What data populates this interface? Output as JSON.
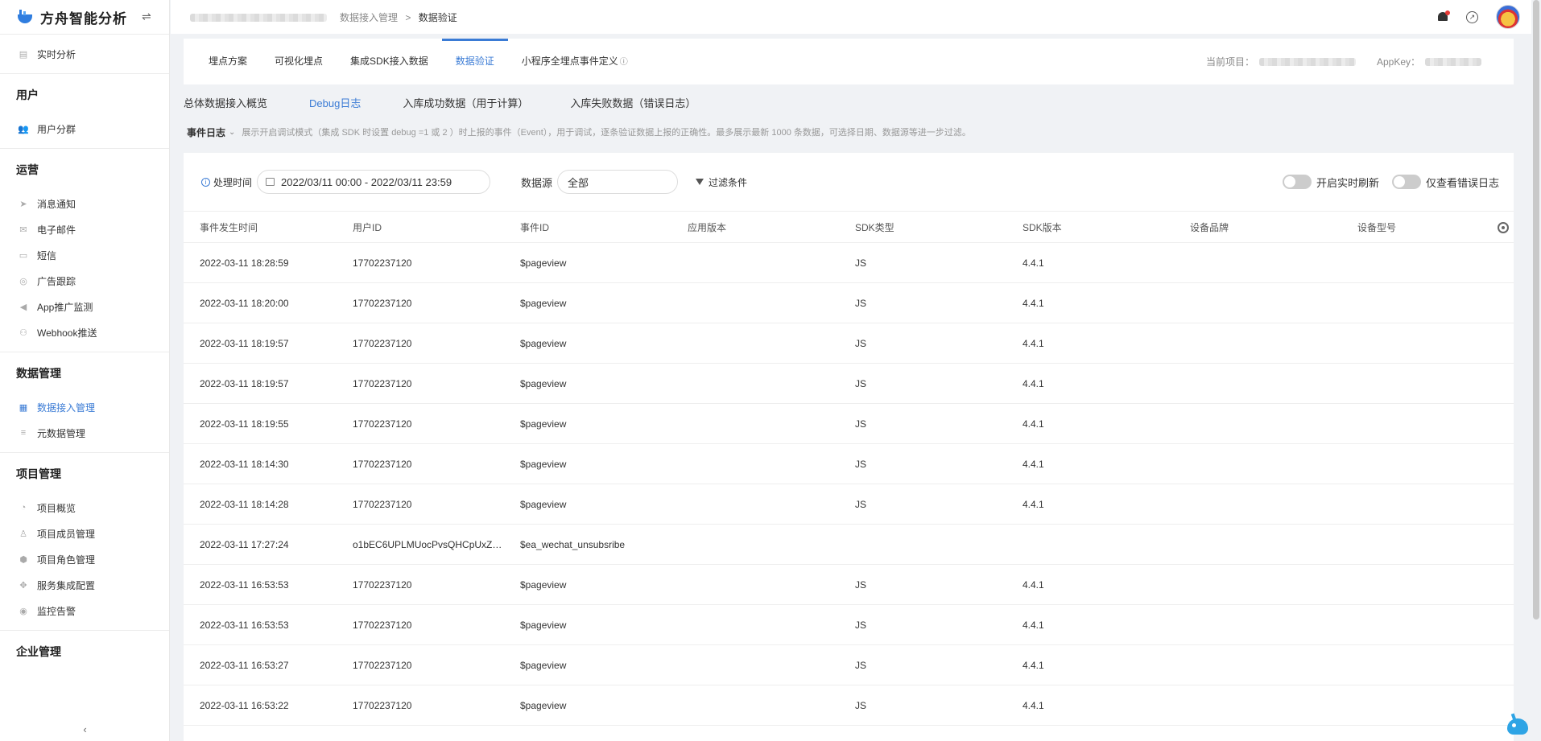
{
  "app": {
    "name": "方舟智能分析",
    "collapse_icon": "swap-icon"
  },
  "sidebar": {
    "items_top": [
      {
        "label": "实时分析",
        "icon": "realtime-icon"
      }
    ],
    "sections": [
      {
        "title": "用户",
        "items": [
          {
            "label": "用户分群",
            "icon": "users-icon"
          }
        ]
      },
      {
        "title": "运营",
        "items": [
          {
            "label": "消息通知",
            "icon": "send-icon"
          },
          {
            "label": "电子邮件",
            "icon": "mail-icon"
          },
          {
            "label": "短信",
            "icon": "chat-icon"
          },
          {
            "label": "广告跟踪",
            "icon": "target-icon"
          },
          {
            "label": "App推广监测",
            "icon": "megaphone-icon"
          },
          {
            "label": "Webhook推送",
            "icon": "robot-icon"
          }
        ]
      },
      {
        "title": "数据管理",
        "items": [
          {
            "label": "数据接入管理",
            "icon": "database-icon",
            "active": true
          },
          {
            "label": "元数据管理",
            "icon": "list-icon"
          }
        ]
      },
      {
        "title": "项目管理",
        "items": [
          {
            "label": "项目概览",
            "icon": "overview-icon"
          },
          {
            "label": "项目成员管理",
            "icon": "member-icon"
          },
          {
            "label": "项目角色管理",
            "icon": "role-icon"
          },
          {
            "label": "服务集成配置",
            "icon": "puzzle-icon"
          },
          {
            "label": "监控告警",
            "icon": "alarm-icon"
          }
        ]
      },
      {
        "title": "企业管理",
        "items": []
      }
    ],
    "collapse_label": "‹"
  },
  "topbar": {
    "breadcrumb": [
      "数据接入管理",
      "数据验证"
    ],
    "breadcrumb_sep": ">"
  },
  "tabs": [
    {
      "label": "埋点方案"
    },
    {
      "label": "可视化埋点"
    },
    {
      "label": "集成SDK接入数据"
    },
    {
      "label": "数据验证",
      "active": true
    },
    {
      "label": "小程序全埋点事件定义",
      "info": "ⓘ"
    }
  ],
  "project": {
    "current_label": "当前项目：",
    "appkey_label": "AppKey："
  },
  "subtabs": [
    {
      "label": "总体数据接入概览"
    },
    {
      "label": "Debug日志",
      "active": true
    },
    {
      "label": "入库成功数据（用于计算）"
    },
    {
      "label": "入库失败数据（错误日志）"
    }
  ],
  "event_log": {
    "title": "事件日志",
    "description": "展示开启调试模式（集成 SDK 时设置 debug =1 或 2 ）时上报的事件（Event），用于调试，逐条验证数据上报的正确性。最多展示最新 1000 条数据，可选择日期、数据源等进一步过滤。"
  },
  "filters": {
    "time_label": "处理时间",
    "date_range": "2022/03/11 00:00 - 2022/03/11 23:59",
    "source_label": "数据源",
    "source_value": "全部",
    "filter_label": "过滤条件",
    "toggle_realtime": "开启实时刷新",
    "toggle_errors": "仅查看错误日志"
  },
  "table": {
    "columns": [
      "事件发生时间",
      "用户ID",
      "事件ID",
      "应用版本",
      "SDK类型",
      "SDK版本",
      "设备品牌",
      "设备型号"
    ],
    "rows": [
      [
        "2022-03-11 18:28:59",
        "17702237120",
        "$pageview",
        "",
        "JS",
        "4.4.1",
        "",
        ""
      ],
      [
        "2022-03-11 18:20:00",
        "17702237120",
        "$pageview",
        "",
        "JS",
        "4.4.1",
        "",
        ""
      ],
      [
        "2022-03-11 18:19:57",
        "17702237120",
        "$pageview",
        "",
        "JS",
        "4.4.1",
        "",
        ""
      ],
      [
        "2022-03-11 18:19:57",
        "17702237120",
        "$pageview",
        "",
        "JS",
        "4.4.1",
        "",
        ""
      ],
      [
        "2022-03-11 18:19:55",
        "17702237120",
        "$pageview",
        "",
        "JS",
        "4.4.1",
        "",
        ""
      ],
      [
        "2022-03-11 18:14:30",
        "17702237120",
        "$pageview",
        "",
        "JS",
        "4.4.1",
        "",
        ""
      ],
      [
        "2022-03-11 18:14:28",
        "17702237120",
        "$pageview",
        "",
        "JS",
        "4.4.1",
        "",
        ""
      ],
      [
        "2022-03-11 17:27:24",
        "o1bEC6UPLMUocPvsQHCpUxZky...",
        "$ea_wechat_unsubsribe",
        "",
        "",
        "",
        "",
        ""
      ],
      [
        "2022-03-11 16:53:53",
        "17702237120",
        "$pageview",
        "",
        "JS",
        "4.4.1",
        "",
        ""
      ],
      [
        "2022-03-11 16:53:53",
        "17702237120",
        "$pageview",
        "",
        "JS",
        "4.4.1",
        "",
        ""
      ],
      [
        "2022-03-11 16:53:27",
        "17702237120",
        "$pageview",
        "",
        "JS",
        "4.4.1",
        "",
        ""
      ],
      [
        "2022-03-11 16:53:22",
        "17702237120",
        "$pageview",
        "",
        "JS",
        "4.4.1",
        "",
        ""
      ]
    ]
  }
}
